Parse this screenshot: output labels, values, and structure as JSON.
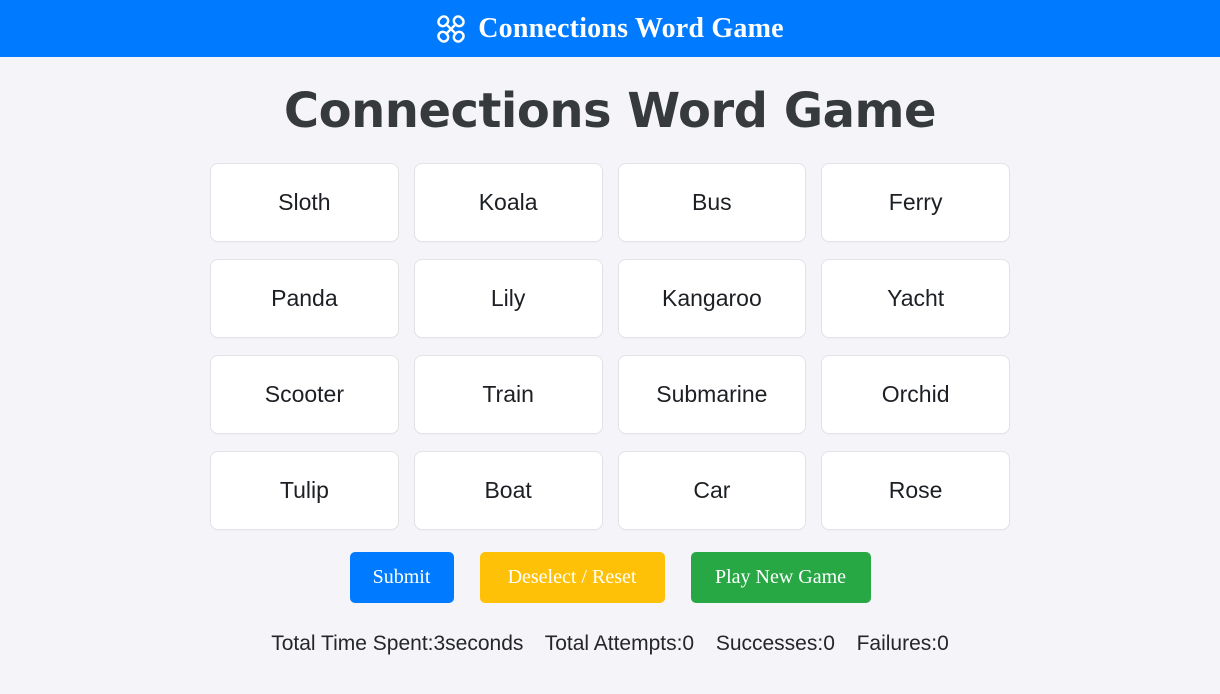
{
  "navbar": {
    "brand_text": "Connections Word Game",
    "brand_icon": "clover-connections-icon",
    "background_color": "#007bff",
    "text_color": "#ffffff"
  },
  "page": {
    "title": "Connections Word Game",
    "background_color": "#f4f4f9",
    "title_color": "#373a3c"
  },
  "grid": {
    "rows": 4,
    "columns": 4,
    "tiles": [
      {
        "label": "Sloth"
      },
      {
        "label": "Koala"
      },
      {
        "label": "Bus"
      },
      {
        "label": "Ferry"
      },
      {
        "label": "Panda"
      },
      {
        "label": "Lily"
      },
      {
        "label": "Kangaroo"
      },
      {
        "label": "Yacht"
      },
      {
        "label": "Scooter"
      },
      {
        "label": "Train"
      },
      {
        "label": "Submarine"
      },
      {
        "label": "Orchid"
      },
      {
        "label": "Tulip"
      },
      {
        "label": "Boat"
      },
      {
        "label": "Car"
      },
      {
        "label": "Rose"
      }
    ]
  },
  "actions": {
    "submit_label": "Submit",
    "reset_label": "Deselect / Reset",
    "new_game_label": "Play New Game",
    "submit_color": "#007bff",
    "reset_color": "#ffc107",
    "new_game_color": "#28a745"
  },
  "status": {
    "time_spent": "Total Time Spent:3seconds",
    "attempts": "Total Attempts:0",
    "successes": "Successes:0",
    "failures": "Failures:0"
  }
}
